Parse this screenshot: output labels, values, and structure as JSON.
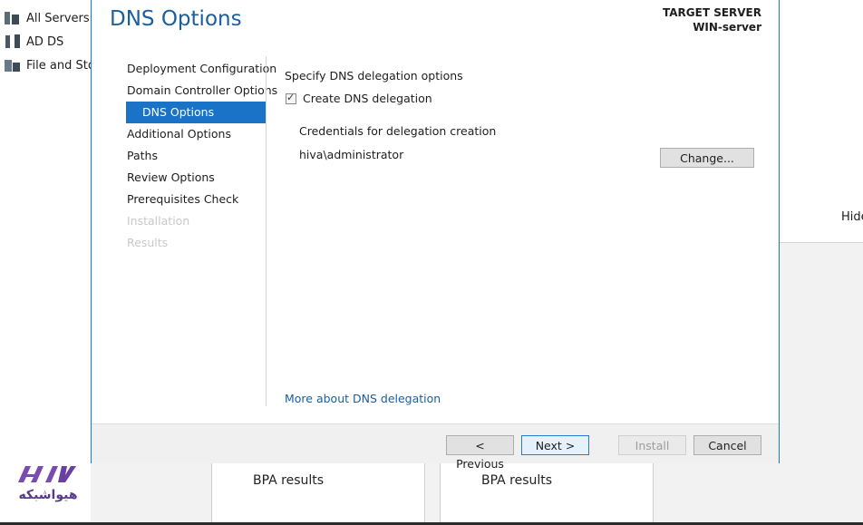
{
  "background": {
    "nav_items": [
      "All Servers",
      "AD DS",
      "File and Sto"
    ],
    "hide_label": "Hide",
    "tiles": [
      "BPA results",
      "BPA results"
    ]
  },
  "watermark": {
    "text": "هیواشبکه"
  },
  "dialog": {
    "title": "DNS Options",
    "target_server_label": "TARGET SERVER",
    "target_server_value": "WIN-server",
    "steps": [
      {
        "label": "Deployment Configuration",
        "state": "normal"
      },
      {
        "label": "Domain Controller Options",
        "state": "normal"
      },
      {
        "label": "DNS Options",
        "state": "active"
      },
      {
        "label": "Additional Options",
        "state": "normal"
      },
      {
        "label": "Paths",
        "state": "normal"
      },
      {
        "label": "Review Options",
        "state": "normal"
      },
      {
        "label": "Prerequisites Check",
        "state": "normal"
      },
      {
        "label": "Installation",
        "state": "disabled"
      },
      {
        "label": "Results",
        "state": "disabled"
      }
    ],
    "content": {
      "heading": "Specify DNS delegation options",
      "checkbox_label": "Create DNS delegation",
      "checkbox_checked": true,
      "credentials_label": "Credentials for delegation creation",
      "credentials_value": "hiva\\administrator",
      "change_button": "Change...",
      "more_link": "More about DNS delegation"
    },
    "footer": {
      "previous": "< Previous",
      "next": "Next >",
      "install": "Install",
      "cancel": "Cancel"
    }
  },
  "colors": {
    "accent": "#1a73c6",
    "title": "#1a5fa0",
    "link": "#1a5fa0",
    "disabled_text": "#c8c8c8",
    "footer_bg": "#f0f0f0"
  }
}
